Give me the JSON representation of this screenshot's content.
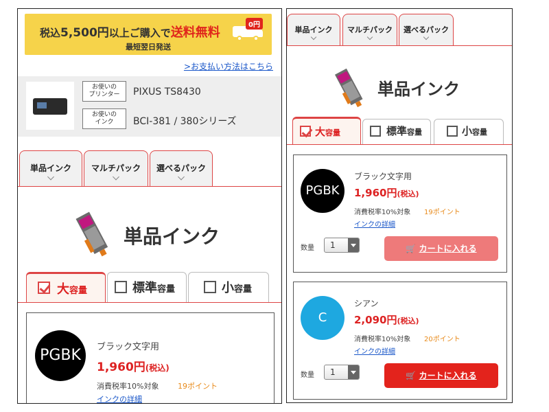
{
  "banner": {
    "prefix": "税込",
    "amount": "5,500円",
    "middle": "以上ご購入で",
    "free_shipping": "送料無料",
    "badge": "0円",
    "subtext": "最短翌日発送"
  },
  "payment_link": ">お支払い方法はこちら",
  "printer_info": {
    "printer_tag": [
      "お使いの",
      "プリンター"
    ],
    "printer_name": "PIXUS TS8430",
    "ink_tag": [
      "お使いの",
      "インク"
    ],
    "ink_series": "BCI-381 / 380シリーズ"
  },
  "tabs": [
    "単品インク",
    "マルチパック",
    "選べるパック"
  ],
  "section_title": "単品インク",
  "capacity": [
    {
      "main": "大",
      "suffix": "容量",
      "checked": true
    },
    {
      "main": "標準",
      "suffix": "容量",
      "checked": false
    },
    {
      "main": "小",
      "suffix": "容量",
      "checked": false
    }
  ],
  "products": [
    {
      "code": "PGBK",
      "color": "#000000",
      "name": "ブラック文字用",
      "price": "1,960円",
      "tax_label": "(税込)",
      "tax_note": "消費税率10%対象",
      "points": "19ポイント",
      "detail_link": "インクの詳細",
      "qty_label": "数量",
      "qty": "1",
      "cart_label": "カートに入れる",
      "cart_color": "#ee7a7a"
    },
    {
      "code": "C",
      "color": "#1ea8e0",
      "name": "シアン",
      "price": "2,090円",
      "tax_label": "(税込)",
      "tax_note": "消費税率10%対象",
      "points": "20ポイント",
      "detail_link": "インクの詳細",
      "qty_label": "数量",
      "qty": "1",
      "cart_label": "カートに入れる",
      "cart_color": "#e3231c"
    }
  ],
  "colors": {
    "accent_red": "#d22222",
    "banner_yellow": "#f6d34a",
    "link_blue": "#1a57c9",
    "points_orange": "#e88a1a"
  }
}
